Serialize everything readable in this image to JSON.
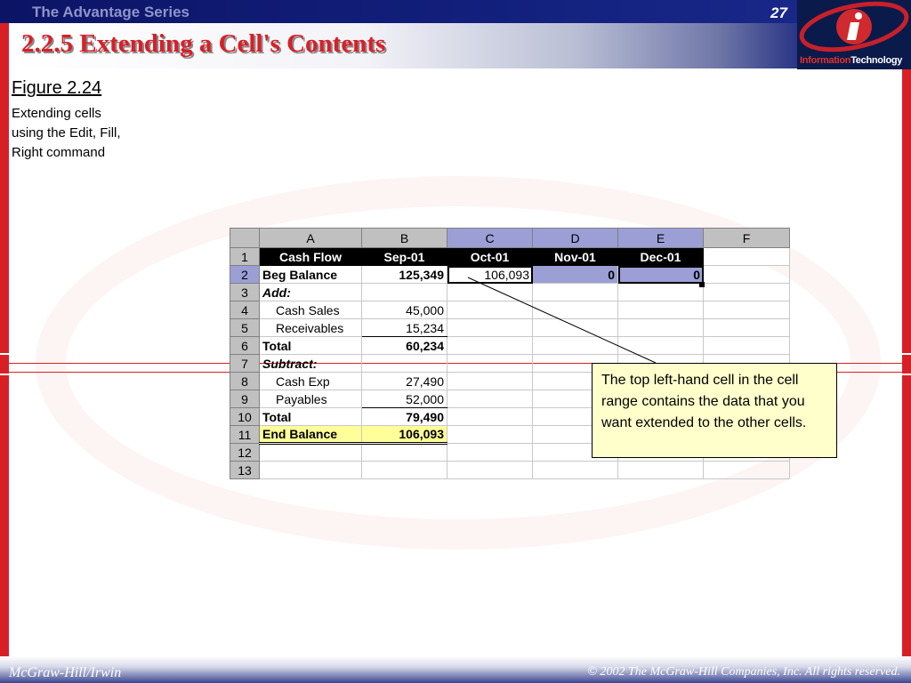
{
  "header": {
    "series": "The Advantage Series",
    "slide_number": "27",
    "title": "2.2.5 Extending a Cell's Contents"
  },
  "logo": {
    "icon": "information-technology-logo-icon",
    "text_a": "Information",
    "text_b": "Technology"
  },
  "figure": {
    "title": "Figure 2.24",
    "description": "Extending cells using the Edit, Fill, Right command"
  },
  "spreadsheet": {
    "columns": [
      "A",
      "B",
      "C",
      "D",
      "E",
      "F"
    ],
    "rows": [
      {
        "n": "1",
        "a": "Cash Flow",
        "b": "Sep-01",
        "c": "Oct-01",
        "d": "Nov-01",
        "e": "Dec-01",
        "f": ""
      },
      {
        "n": "2",
        "a": "Beg Balance",
        "b": "125,349",
        "c": "106,093",
        "d": "0",
        "e": "0",
        "f": ""
      },
      {
        "n": "3",
        "a": "Add:",
        "b": "",
        "c": "",
        "d": "",
        "e": "",
        "f": ""
      },
      {
        "n": "4",
        "a": "Cash Sales",
        "b": "45,000",
        "c": "",
        "d": "",
        "e": "",
        "f": ""
      },
      {
        "n": "5",
        "a": "Receivables",
        "b": "15,234",
        "c": "",
        "d": "",
        "e": "",
        "f": ""
      },
      {
        "n": "6",
        "a": "Total",
        "b": "60,234",
        "c": "",
        "d": "",
        "e": "",
        "f": ""
      },
      {
        "n": "7",
        "a": "Subtract:",
        "b": "",
        "c": "",
        "d": "",
        "e": "",
        "f": ""
      },
      {
        "n": "8",
        "a": "Cash Exp",
        "b": "27,490",
        "c": "",
        "d": "",
        "e": "",
        "f": ""
      },
      {
        "n": "9",
        "a": "Payables",
        "b": "52,000",
        "c": "",
        "d": "",
        "e": "",
        "f": ""
      },
      {
        "n": "10",
        "a": "Total",
        "b": "79,490",
        "c": "",
        "d": "",
        "e": "",
        "f": ""
      },
      {
        "n": "11",
        "a": "End Balance",
        "b": "106,093",
        "c": "",
        "d": "",
        "e": "",
        "f": ""
      },
      {
        "n": "12",
        "a": "",
        "b": "",
        "c": "",
        "d": "",
        "e": "",
        "f": ""
      },
      {
        "n": "13",
        "a": "",
        "b": "",
        "c": "",
        "d": "",
        "e": "",
        "f": ""
      }
    ],
    "selection_color": "#9b9fd6",
    "highlight_color": "#ffff99"
  },
  "callout": {
    "text": "The top left-hand cell in the cell range contains the data that you want extended to the other cells."
  },
  "footer": {
    "left": "McGraw-Hill/Irwin",
    "right": "© 2002  The McGraw-Hill Companies, Inc. All rights reserved."
  },
  "colors": {
    "accent_red": "#d91f26",
    "banner_blue": "#13217f",
    "callout_bg": "#ffffcc"
  }
}
